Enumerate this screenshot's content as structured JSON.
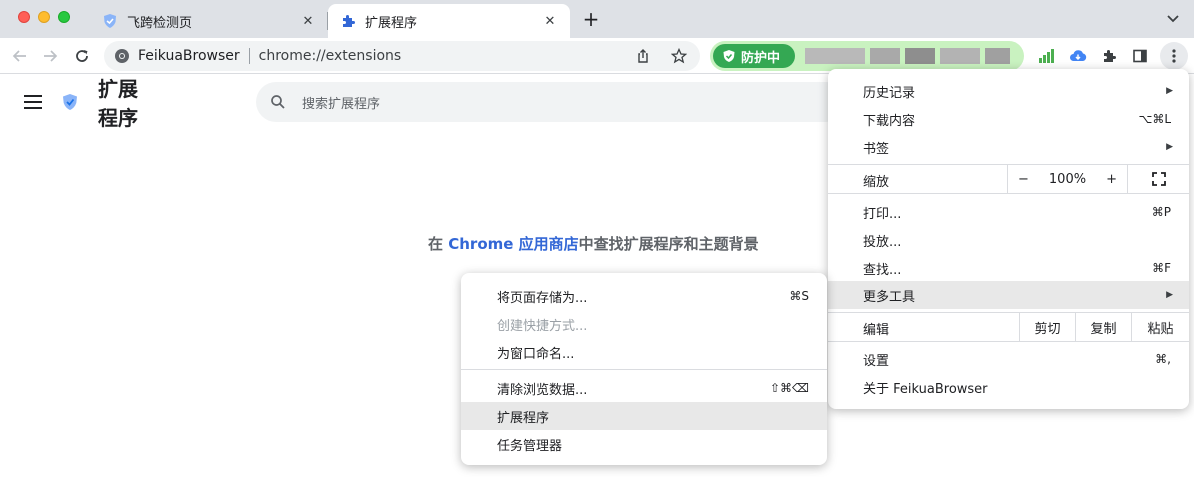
{
  "tabs": [
    {
      "title": "飞跨检测页",
      "icon": "shield-icon"
    },
    {
      "title": "扩展程序",
      "icon": "puzzle-icon"
    }
  ],
  "omnibox": {
    "site_name": "FeikuaBrowser",
    "url": "chrome://extensions"
  },
  "shield_badge": {
    "label": "防护中"
  },
  "page": {
    "title": "扩展\n程序",
    "search_placeholder": "搜索扩展程序",
    "store_prefix": "在 ",
    "store_link": "Chrome 应用商店",
    "store_suffix": "中查找扩展程序和主题背景"
  },
  "menu": {
    "history": "历史记录",
    "downloads": "下载内容",
    "downloads_shortcut": "⌥⌘L",
    "bookmarks": "书签",
    "zoom": "缩放",
    "zoom_minus": "−",
    "zoom_value": "100%",
    "zoom_plus": "+",
    "print": "打印...",
    "print_shortcut": "⌘P",
    "cast": "投放...",
    "find": "查找...",
    "find_shortcut": "⌘F",
    "more_tools": "更多工具",
    "edit": "编辑",
    "cut": "剪切",
    "copy": "复制",
    "paste": "粘贴",
    "settings": "设置",
    "settings_shortcut": "⌘,",
    "about": "关于 FeikuaBrowser"
  },
  "submenu": {
    "save_page": "将页面存储为...",
    "save_page_shortcut": "⌘S",
    "create_shortcut": "创建快捷方式...",
    "name_window": "为窗口命名...",
    "clear_data": "清除浏览数据...",
    "clear_data_shortcut": "⇧⌘⌫",
    "extensions": "扩展程序",
    "task_manager": "任务管理器"
  },
  "colors": {
    "accent": "#3367d6",
    "shield_green": "#34a853",
    "highlight": "#e8e8e8"
  }
}
